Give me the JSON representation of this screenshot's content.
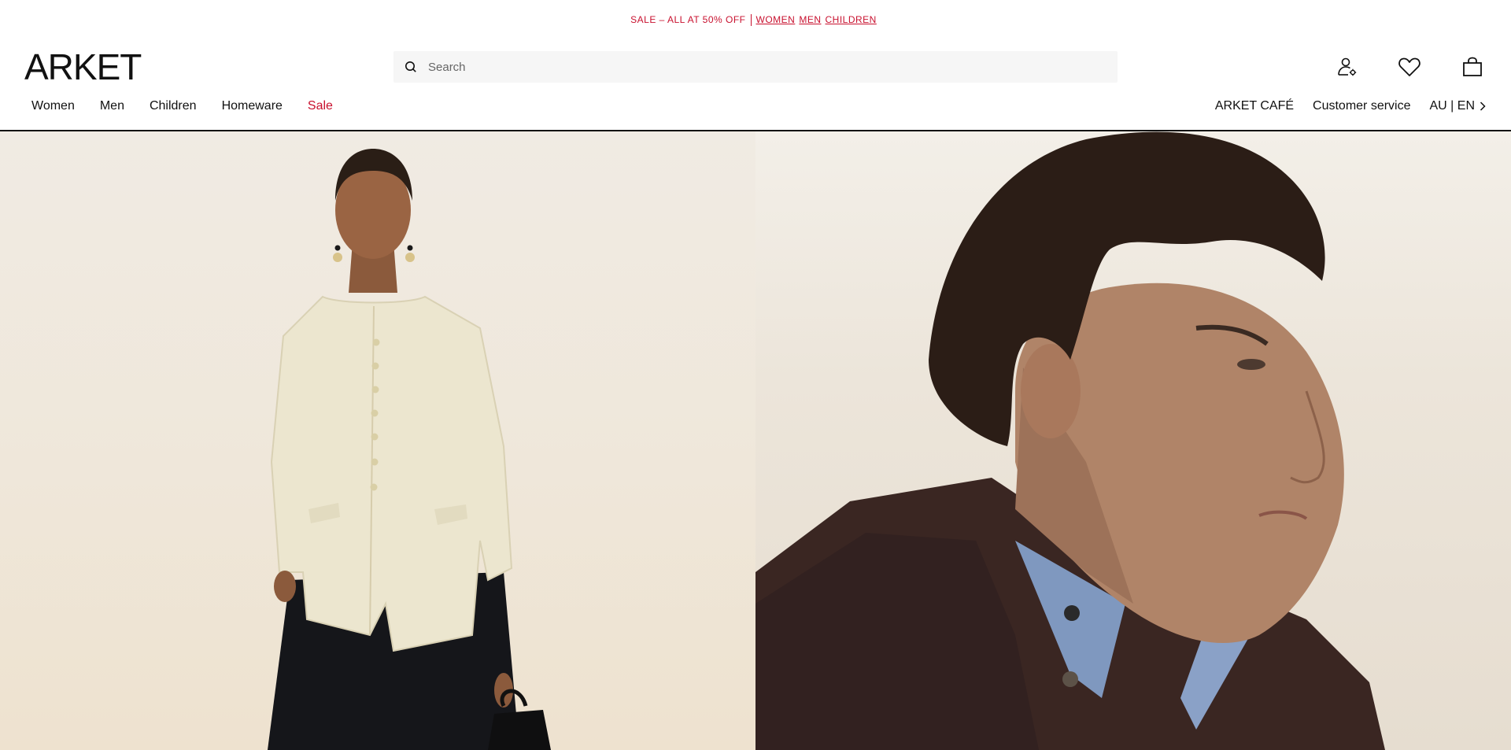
{
  "promo": {
    "text": "SALE – ALL AT 50% OFF",
    "links": [
      "WOMEN",
      "MEN",
      "CHILDREN"
    ]
  },
  "header": {
    "logo": "ARKET",
    "search": {
      "placeholder": "Search",
      "value": ""
    },
    "icons": [
      "account-icon",
      "wishlist-heart-icon",
      "shopping-bag-icon"
    ]
  },
  "nav": {
    "items": [
      "Women",
      "Men",
      "Children",
      "Homeware",
      "Sale"
    ],
    "right": [
      "ARKET CAFÉ",
      "Customer service"
    ],
    "locale": "AU | EN"
  },
  "colors": {
    "sale_red": "#c8102e",
    "text": "#111111",
    "search_bg": "#f6f6f6"
  },
  "hero": {
    "panels": [
      "women-campaign-image",
      "men-campaign-image"
    ]
  }
}
